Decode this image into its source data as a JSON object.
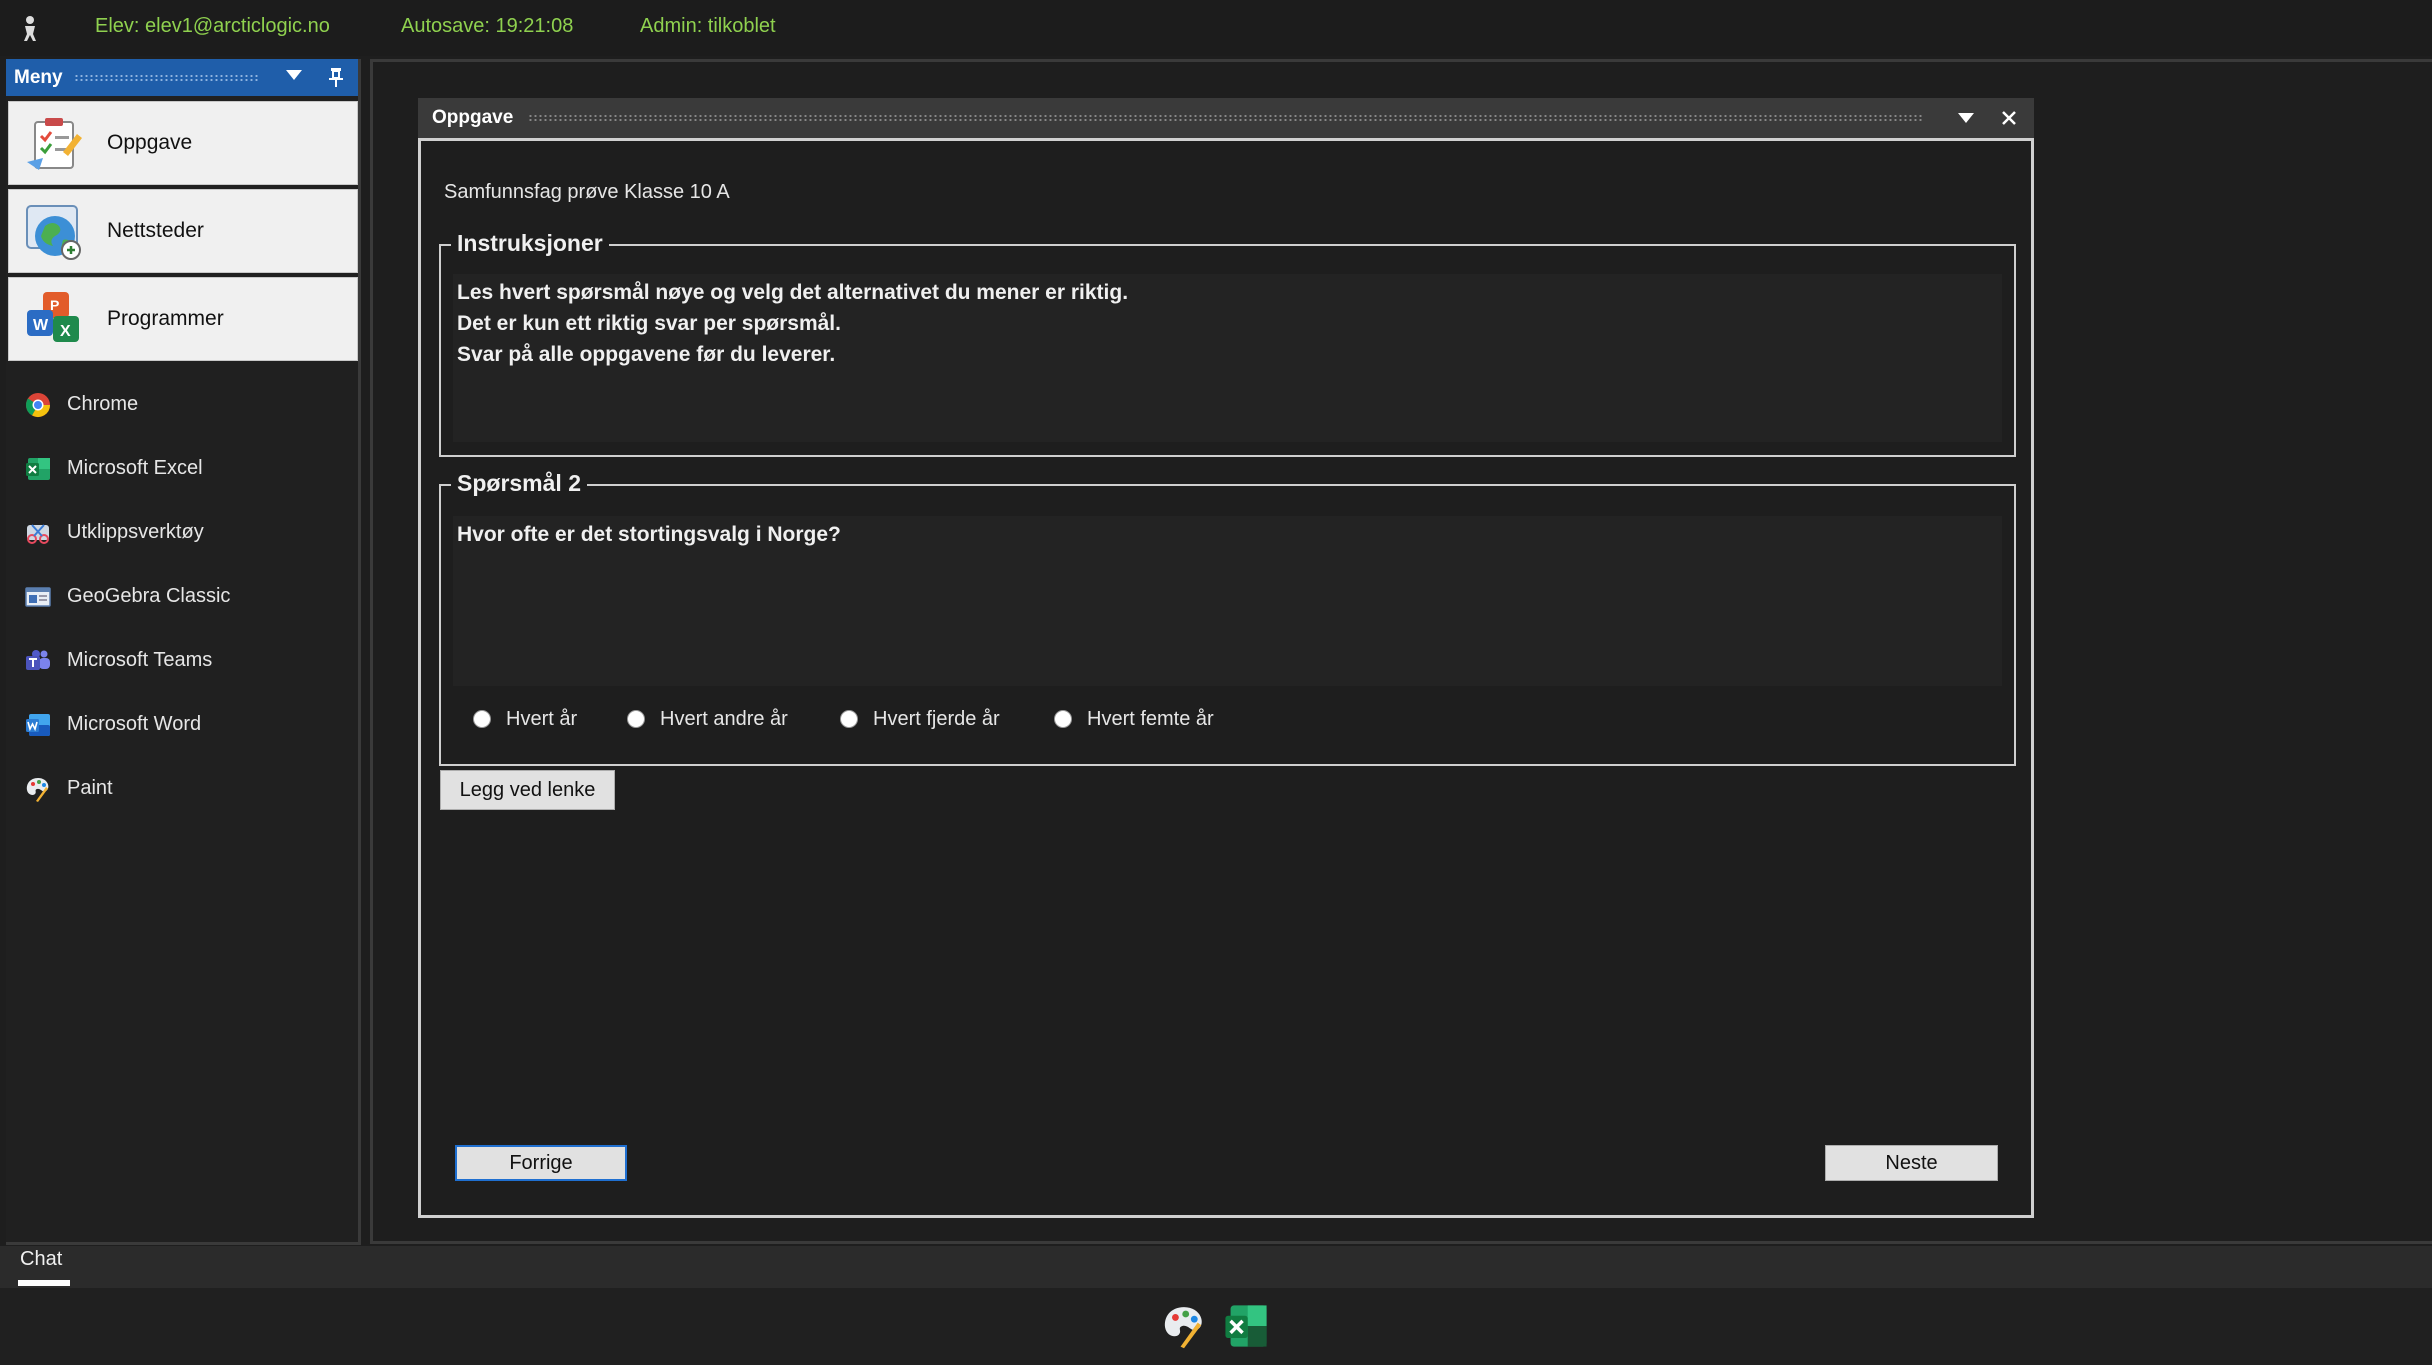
{
  "topbar": {
    "student": "Elev: elev1@arcticlogic.no",
    "autosave": "Autosave: 19:21:08",
    "admin": "Admin: tilkoblet",
    "status_color": "#8fd14f"
  },
  "sidebar": {
    "title": "Meny",
    "big_items": [
      {
        "label": "Oppgave",
        "icon": "task-icon"
      },
      {
        "label": "Nettsteder",
        "icon": "globe-icon"
      },
      {
        "label": "Programmer",
        "icon": "office-apps-icon"
      }
    ],
    "apps": [
      {
        "label": "Chrome",
        "icon": "chrome-icon"
      },
      {
        "label": "Microsoft Excel",
        "icon": "excel-icon"
      },
      {
        "label": "Utklippsverktøy",
        "icon": "snipping-tool-icon"
      },
      {
        "label": "GeoGebra Classic",
        "icon": "geogebra-icon"
      },
      {
        "label": "Microsoft Teams",
        "icon": "teams-icon"
      },
      {
        "label": "Microsoft Word",
        "icon": "word-icon"
      },
      {
        "label": "Paint",
        "icon": "paint-icon"
      }
    ],
    "accent_color": "#1f5eaa"
  },
  "dialog": {
    "title": "Oppgave",
    "subtitle": "Samfunnsfag prøve Klasse 10 A",
    "instructions": {
      "legend": "Instruksjoner",
      "lines": [
        "Les hvert spørsmål nøye og velg det alternativet du mener er riktig.",
        "Det er kun ett riktig svar per spørsmål.",
        "Svar på alle oppgavene før du leverer."
      ]
    },
    "question": {
      "legend": "Spørsmål 2",
      "text": "Hvor ofte er det stortingsvalg i Norge?",
      "options": [
        "Hvert år",
        "Hvert andre år",
        "Hvert fjerde år",
        "Hvert femte år"
      ]
    },
    "attach_link_label": "Legg ved lenke",
    "prev_label": "Forrige",
    "next_label": "Neste",
    "prev_border_color": "#1f6fd0"
  },
  "chat": {
    "label": "Chat"
  },
  "taskbar": {
    "icons": [
      "paint-icon",
      "excel-icon"
    ]
  }
}
